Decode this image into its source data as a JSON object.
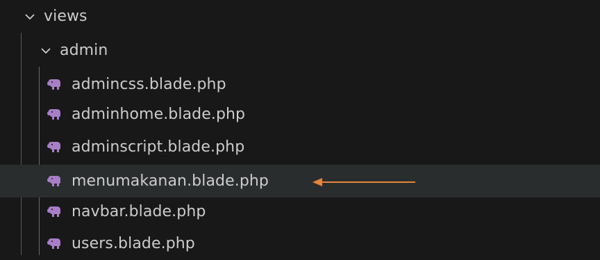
{
  "explorer": {
    "tree": {
      "views": {
        "label": "views",
        "expanded": true,
        "icon": "chevron-down-icon"
      },
      "admin": {
        "label": "admin",
        "expanded": true,
        "icon": "chevron-down-icon"
      },
      "files": [
        {
          "label": "admincss.blade.php",
          "icon": "php-elephant-icon"
        },
        {
          "label": "adminhome.blade.php",
          "icon": "php-elephant-icon"
        },
        {
          "label": "adminscript.blade.php",
          "icon": "php-elephant-icon"
        },
        {
          "label": "menumakanan.blade.php",
          "icon": "php-elephant-icon",
          "selected": true
        },
        {
          "label": "navbar.blade.php",
          "icon": "php-elephant-icon"
        },
        {
          "label": "users.blade.php",
          "icon": "php-elephant-icon"
        }
      ]
    }
  },
  "annotation": {
    "type": "arrow",
    "color": "#e8853a",
    "points_to": "menumakanan.blade.php"
  },
  "colors": {
    "background": "#181818",
    "selected_row": "#2a2d2e",
    "text": "#cccccc",
    "php_icon": "#a97ec7",
    "indent_guide": "#585858"
  }
}
